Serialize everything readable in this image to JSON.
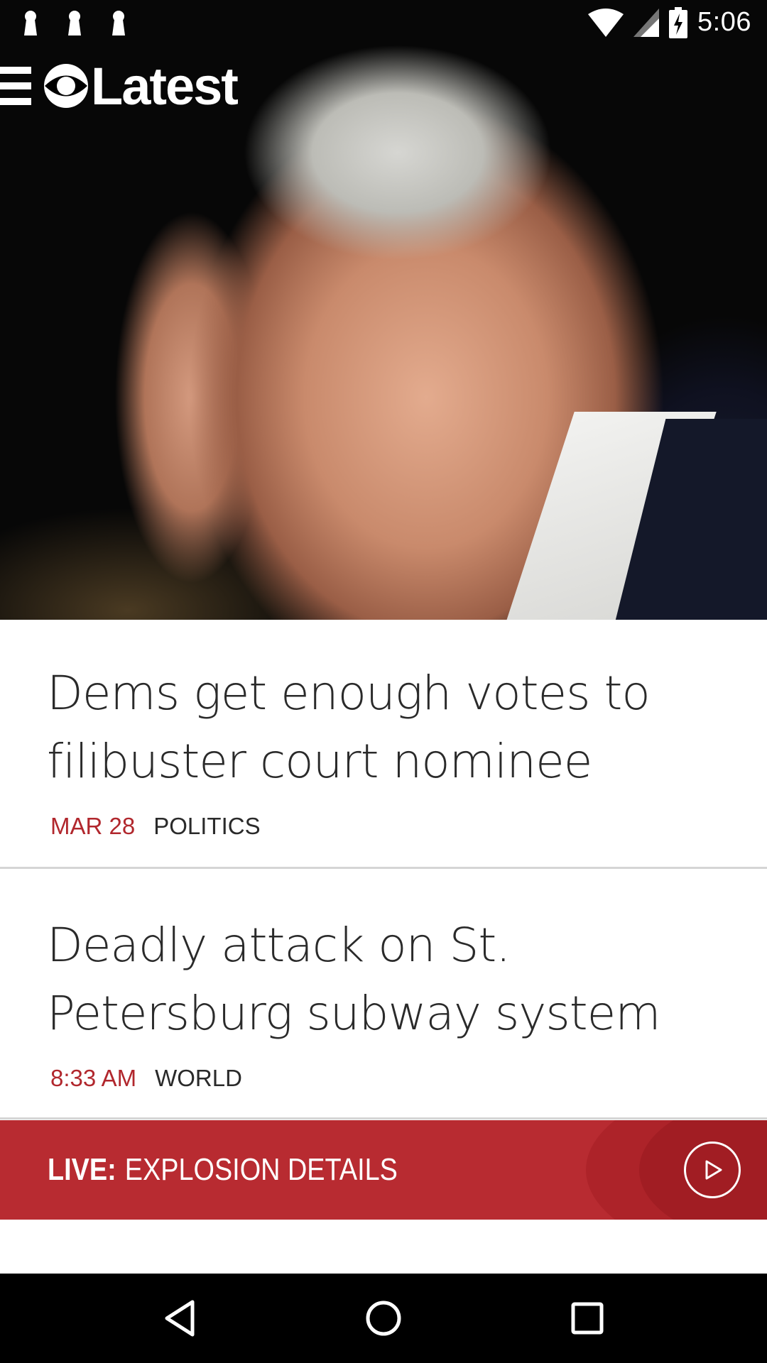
{
  "status_bar": {
    "time": "5:06",
    "icons": [
      "keyhole-icon",
      "keyhole-icon",
      "keyhole-icon",
      "wifi-icon",
      "cell-signal-icon",
      "battery-charging-icon"
    ]
  },
  "header": {
    "menu_icon": "hamburger-menu-icon",
    "logo_icon": "cbs-eye-icon",
    "logo_text": "Latest"
  },
  "hero": {
    "image": "photo-man-hand-on-forehead"
  },
  "articles": [
    {
      "title": "Dems get enough votes to filibuster court nominee",
      "time": "MAR 28",
      "category": "POLITICS"
    },
    {
      "title": "Deadly attack on St. Petersburg subway system",
      "time": "8:33 AM",
      "category": "WORLD"
    }
  ],
  "live": {
    "label": "LIVE:",
    "text": "EXPLOSION DETAILS",
    "icon": "play-circle-icon"
  },
  "nav_bar": {
    "icons": [
      "back-icon",
      "home-icon",
      "recents-icon"
    ]
  },
  "colors": {
    "accent_red": "#b82b31",
    "meta_red": "#b1272d",
    "text_dark": "#2a2a2a"
  }
}
